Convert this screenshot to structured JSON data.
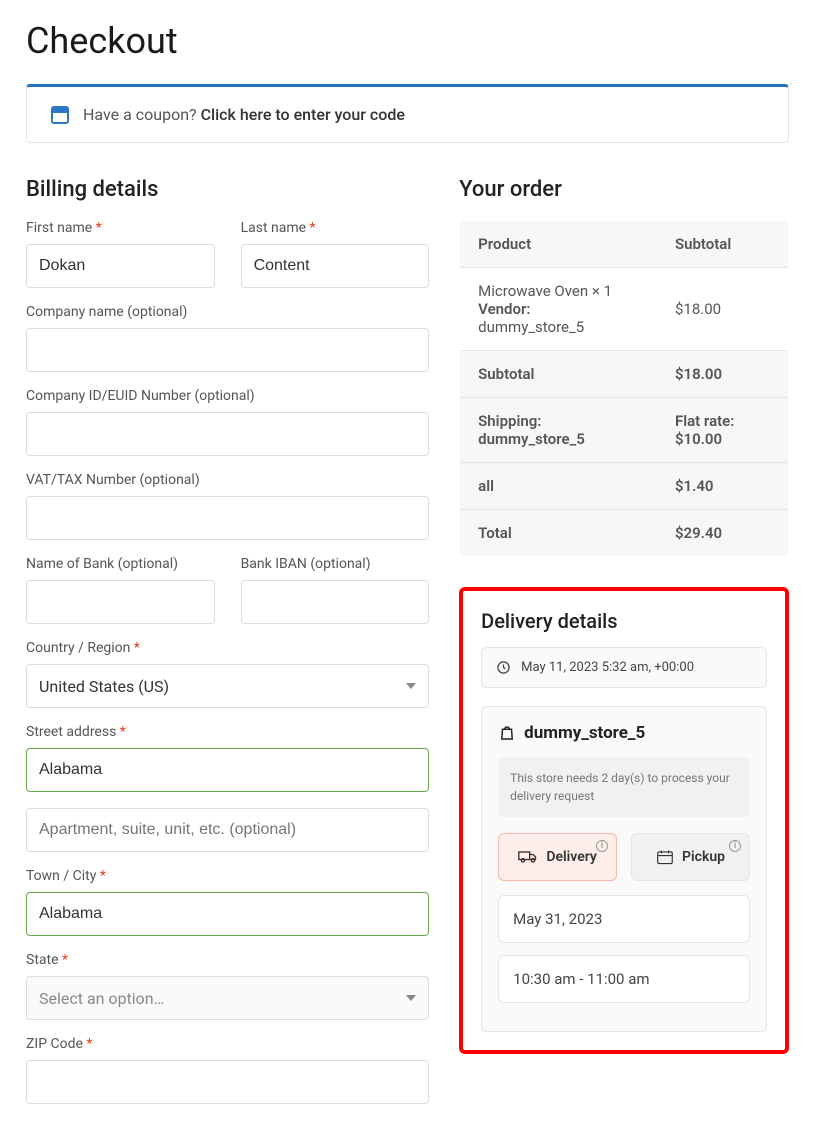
{
  "page": {
    "title": "Checkout",
    "coupon_prefix": "Have a coupon?",
    "coupon_link": "Click here to enter your code"
  },
  "billing": {
    "title": "Billing details",
    "first_name_label": "First name",
    "first_name_value": "Dokan",
    "last_name_label": "Last name",
    "last_name_value": "Content",
    "company_label": "Company name (optional)",
    "company_value": "",
    "company_id_label": "Company ID/EUID Number (optional)",
    "company_id_value": "",
    "vat_label": "VAT/TAX Number (optional)",
    "vat_value": "",
    "bank_name_label": "Name of Bank (optional)",
    "bank_name_value": "",
    "bank_iban_label": "Bank IBAN (optional)",
    "bank_iban_value": "",
    "country_label": "Country / Region",
    "country_value": "United States (US)",
    "street_label": "Street address",
    "street_value": "Alabama",
    "street2_placeholder": "Apartment, suite, unit, etc. (optional)",
    "city_label": "Town / City",
    "city_value": "Alabama",
    "state_label": "State",
    "state_placeholder": "Select an option…",
    "zip_label": "ZIP Code",
    "zip_value": ""
  },
  "order": {
    "title": "Your order",
    "head_product": "Product",
    "head_subtotal": "Subtotal",
    "item_name": "Microwave Oven  × 1",
    "vendor_prefix": "Vendor:",
    "vendor_name": "dummy_store_5",
    "item_price": "$18.00",
    "subtotal_label": "Subtotal",
    "subtotal_value": "$18.00",
    "shipping_label": "Shipping: dummy_store_5",
    "shipping_value_line1": "Flat rate:",
    "shipping_value_line2": "$10.00",
    "all_label": "all",
    "all_value": "$1.40",
    "total_label": "Total",
    "total_value": "$29.40"
  },
  "delivery": {
    "title": "Delivery details",
    "timestamp": "May 11, 2023 5:32 am, +00:00",
    "store_name": "dummy_store_5",
    "notice": "This store needs 2 day(s) to process your delivery request",
    "delivery_label": "Delivery",
    "pickup_label": "Pickup",
    "date_value": "May 31, 2023",
    "time_value": "10:30 am - 11:00 am"
  }
}
